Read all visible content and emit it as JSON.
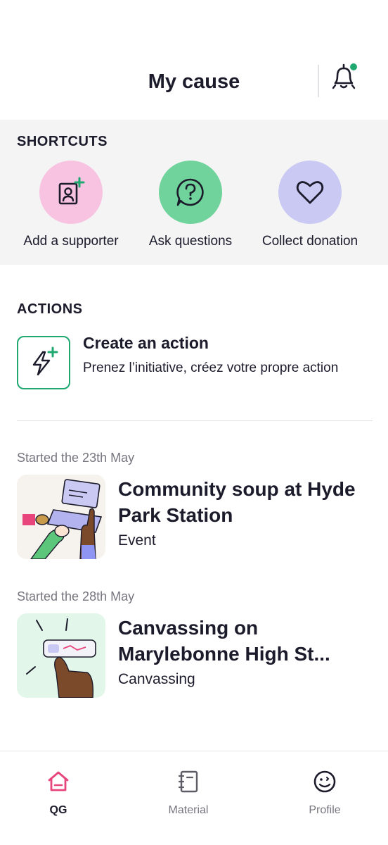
{
  "header": {
    "title": "My cause",
    "notification_dot": true
  },
  "colors": {
    "accent": "#1fa971",
    "pink": "#f8c3e0",
    "green": "#6fd39b",
    "lavender": "#c9c9f4",
    "active_tab": "#e8457c"
  },
  "shortcuts": {
    "label": "SHORTCUTS",
    "items": [
      {
        "label": "Add a supporter",
        "icon": "add-user-icon"
      },
      {
        "label": "Ask questions",
        "icon": "question-icon"
      },
      {
        "label": "Collect donation",
        "icon": "heart-icon"
      }
    ]
  },
  "actions": {
    "label": "ACTIONS",
    "create": {
      "title": "Create an action",
      "description": "Prenez l’initiative, créez votre propre action",
      "icon": "bolt-plus-icon"
    },
    "items": [
      {
        "date": "Started the 23th May",
        "title": "Community soup at Hyde Park Station",
        "type": "Event"
      },
      {
        "date": "Started the 28th May",
        "title": "Canvassing on Marylebonne High St...",
        "type": "Canvassing"
      }
    ]
  },
  "tabbar": {
    "tabs": [
      {
        "label": "QG",
        "icon": "home-icon",
        "active": true
      },
      {
        "label": "Material",
        "icon": "notebook-icon",
        "active": false
      },
      {
        "label": "Profile",
        "icon": "smiley-icon",
        "active": false
      }
    ]
  }
}
